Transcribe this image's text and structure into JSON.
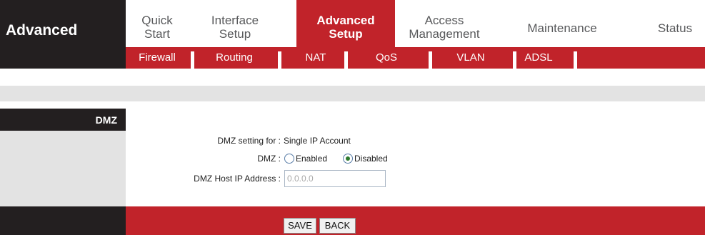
{
  "brand": {
    "title": "Advanced"
  },
  "mainnav": [
    {
      "line1": "Quick",
      "line2": "Start"
    },
    {
      "line1": "Interface",
      "line2": "Setup"
    },
    {
      "line1": "Advanced",
      "line2": "Setup"
    },
    {
      "line1": "Access",
      "line2": "Management"
    },
    {
      "line1": "Maintenance",
      "line2": ""
    },
    {
      "line1": "Status",
      "line2": ""
    }
  ],
  "subnav": [
    "Firewall",
    "Routing",
    "NAT",
    "QoS",
    "VLAN",
    "ADSL"
  ],
  "section": {
    "label": "DMZ"
  },
  "form": {
    "setting_label": "DMZ setting for :",
    "setting_value": "Single IP Account",
    "dmz_label": "DMZ :",
    "enabled_label": "Enabled",
    "disabled_label": "Disabled",
    "selected": "Disabled",
    "host_label": "DMZ Host IP Address :",
    "host_value": "0.0.0.0"
  },
  "buttons": {
    "save": "SAVE",
    "back": "BACK"
  },
  "colors": {
    "accent": "#c1232a",
    "dark": "#231f20",
    "grey": "#e3e3e3"
  }
}
